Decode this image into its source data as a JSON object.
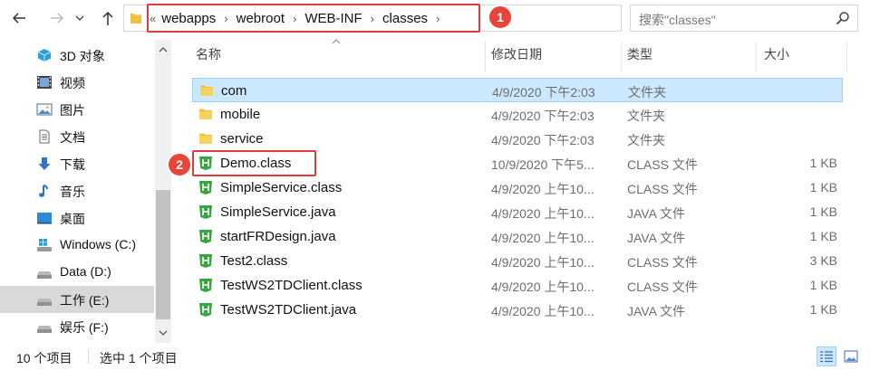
{
  "address": {
    "overflow_glyph": "«",
    "crumbs": [
      "webapps",
      "webroot",
      "WEB-INF",
      "classes"
    ],
    "separator": "›"
  },
  "search": {
    "placeholder": "搜索\"classes\""
  },
  "annotations": {
    "badge1": "1",
    "badge2": "2",
    "color": "#e03c3c"
  },
  "sidebar": {
    "items": [
      {
        "label": "3D 对象",
        "icon": "3d-objects-icon"
      },
      {
        "label": "视频",
        "icon": "video-icon"
      },
      {
        "label": "图片",
        "icon": "pictures-icon"
      },
      {
        "label": "文档",
        "icon": "documents-icon"
      },
      {
        "label": "下载",
        "icon": "download-icon"
      },
      {
        "label": "音乐",
        "icon": "music-icon"
      },
      {
        "label": "桌面",
        "icon": "desktop-icon"
      },
      {
        "label": "Windows (C:)",
        "icon": "windows-drive-icon"
      },
      {
        "label": "Data (D:)",
        "icon": "drive-icon"
      },
      {
        "label": "工作 (E:)",
        "icon": "drive-icon",
        "selected": true
      },
      {
        "label": "娱乐 (F:)",
        "icon": "drive-icon"
      }
    ]
  },
  "columns": {
    "name": "名称",
    "date": "修改日期",
    "type": "类型",
    "size": "大小"
  },
  "files": [
    {
      "name": "com",
      "date": "4/9/2020 下午2:03",
      "type": "文件夹",
      "size": "",
      "kind": "folder",
      "selected": true
    },
    {
      "name": "mobile",
      "date": "4/9/2020 下午2:03",
      "type": "文件夹",
      "size": "",
      "kind": "folder"
    },
    {
      "name": "service",
      "date": "4/9/2020 下午2:03",
      "type": "文件夹",
      "size": "",
      "kind": "folder"
    },
    {
      "name": "Demo.class",
      "date": "10/9/2020 下午5...",
      "type": "CLASS 文件",
      "size": "1 KB",
      "kind": "file"
    },
    {
      "name": "SimpleService.class",
      "date": "4/9/2020 上午10...",
      "type": "CLASS 文件",
      "size": "1 KB",
      "kind": "file"
    },
    {
      "name": "SimpleService.java",
      "date": "4/9/2020 上午10...",
      "type": "JAVA 文件",
      "size": "1 KB",
      "kind": "file"
    },
    {
      "name": "startFRDesign.java",
      "date": "4/9/2020 上午10...",
      "type": "JAVA 文件",
      "size": "1 KB",
      "kind": "file"
    },
    {
      "name": "Test2.class",
      "date": "4/9/2020 上午10...",
      "type": "CLASS 文件",
      "size": "3 KB",
      "kind": "file"
    },
    {
      "name": "TestWS2TDClient.class",
      "date": "4/9/2020 上午10...",
      "type": "CLASS 文件",
      "size": "1 KB",
      "kind": "file"
    },
    {
      "name": "TestWS2TDClient.java",
      "date": "4/9/2020 上午10...",
      "type": "JAVA 文件",
      "size": "1 KB",
      "kind": "file"
    }
  ],
  "status": {
    "count": "10 个项目",
    "selection": "选中 1 个项目"
  },
  "colors": {
    "selection_bg": "#cce8ff",
    "folder": "#f0c040",
    "file_icon": "#3aa343"
  }
}
